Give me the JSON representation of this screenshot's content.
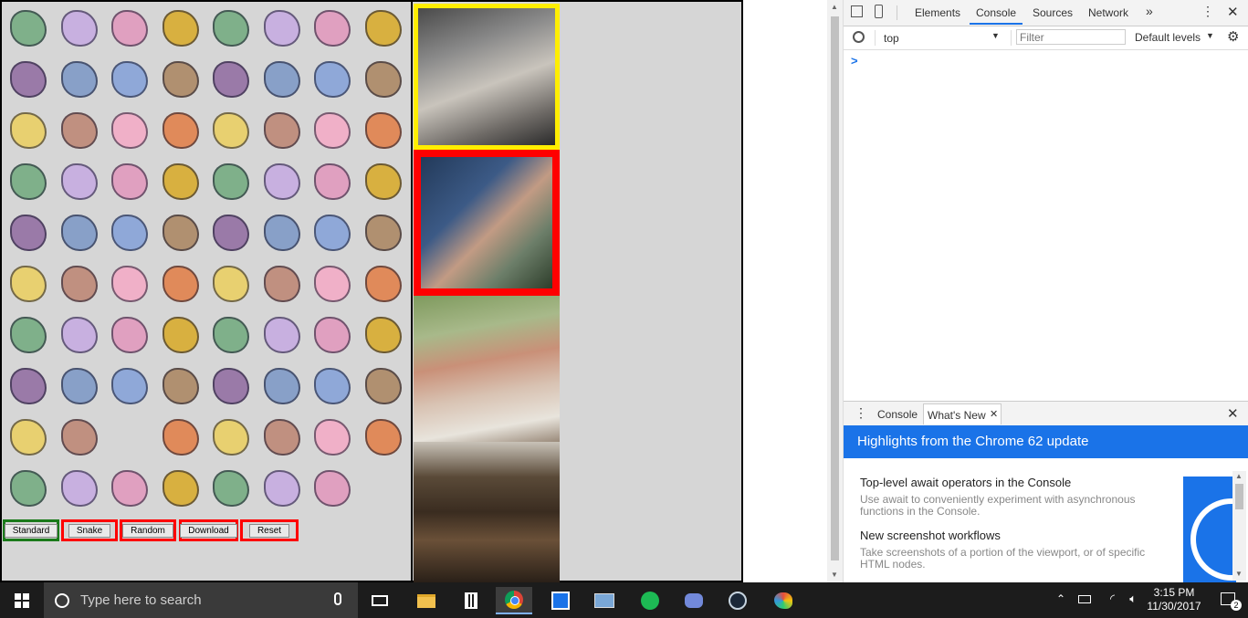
{
  "app": {
    "buttons": [
      {
        "label": "Standard",
        "border_color": "#1a7a1a"
      },
      {
        "label": "Snake",
        "border_color": "#ff0000"
      },
      {
        "label": "Random",
        "border_color": "#ff0000"
      },
      {
        "label": "Download",
        "border_color": "#ff0000"
      },
      {
        "label": "Reset",
        "border_color": "#ff0000"
      }
    ],
    "photo_borders": [
      "#ffee00",
      "#ff0000",
      "none",
      "none"
    ]
  },
  "devtools": {
    "tabs": [
      "Elements",
      "Console",
      "Sources",
      "Network"
    ],
    "active_tab": "Console",
    "more_tabs_glyph": "»",
    "context": "top",
    "filter_placeholder": "Filter",
    "levels": "Default levels",
    "prompt_glyph": ">",
    "drawer_tabs": [
      "Console",
      "What's New"
    ],
    "drawer_banner": "Highlights from the Chrome 62 update",
    "news": [
      {
        "title": "Top-level await operators in the Console",
        "desc": "Use await to conveniently experiment with asynchronous functions in the Console."
      },
      {
        "title": "New screenshot workflows",
        "desc": "Take screenshots of a portion of the viewport, or of specific HTML nodes."
      }
    ]
  },
  "taskbar": {
    "search_placeholder": "Type here to search",
    "time": "3:15 PM",
    "date": "11/30/2017",
    "notification_count": "2"
  },
  "colors": {
    "panel_bg": "#d6d6d6",
    "devtools_blue": "#1a73e8",
    "taskbar_bg": "#1c1c1c"
  }
}
